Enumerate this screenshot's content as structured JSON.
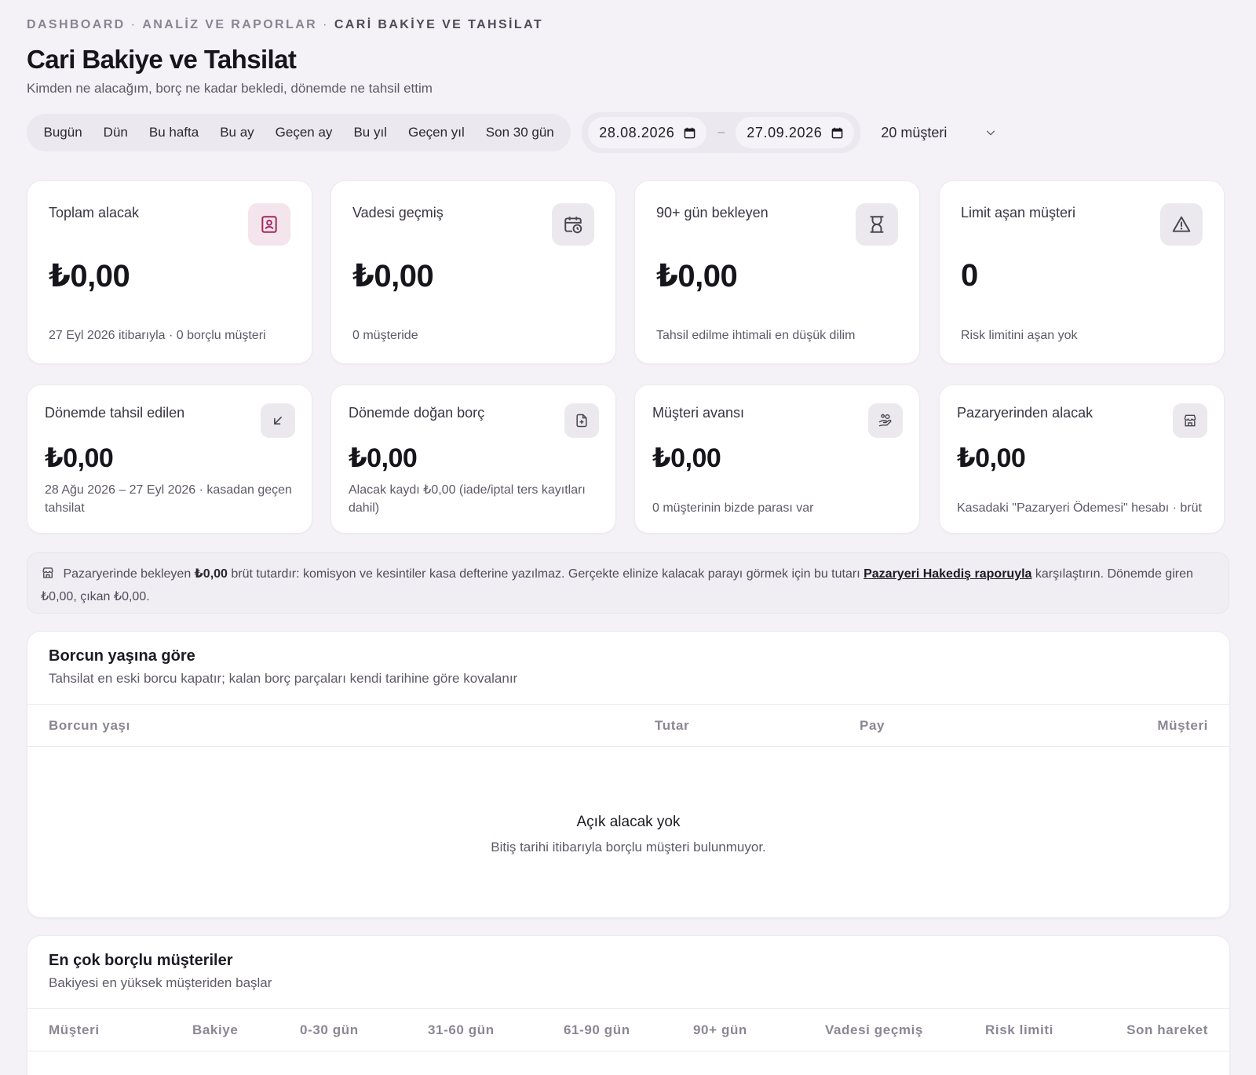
{
  "breadcrumb": {
    "item1": "DASHBOARD",
    "item2": "ANALİZ VE RAPORLAR",
    "item3": "CARİ BAKİYE VE TAHSİLAT",
    "separator": "·"
  },
  "header": {
    "title": "Cari Bakiye ve Tahsilat",
    "subtitle": "Kimden ne alacağım, borç ne kadar bekledi, dönemde ne tahsil ettim"
  },
  "filters": {
    "presets": [
      "Bugün",
      "Dün",
      "Bu hafta",
      "Bu ay",
      "Geçen ay",
      "Bu yıl",
      "Geçen yıl",
      "Son 30 gün"
    ],
    "start_date": "28.08.2026",
    "end_date": "27.09.2026",
    "date_separator": "–",
    "customer_select": "20 müşteri"
  },
  "kpis": [
    {
      "label": "Toplam alacak",
      "value": "₺0,00",
      "note": "27 Eyl 2026 itibarıyla · 0 borçlu müşteri",
      "icon": "contact-book-icon"
    },
    {
      "label": "Vadesi geçmiş",
      "value": "₺0,00",
      "note": "0 müşteride",
      "icon": "calendar-clock-icon"
    },
    {
      "label": "90+ gün bekleyen",
      "value": "₺0,00",
      "note": "Tahsil edilme ihtimali en düşük dilim",
      "icon": "hourglass-icon"
    },
    {
      "label": "Limit aşan müşteri",
      "value": "0",
      "note": "Risk limitini aşan yok",
      "icon": "warning-triangle-icon"
    }
  ],
  "period_kpis": [
    {
      "label": "Dönemde tahsil edilen",
      "value": "₺0,00",
      "note": "28 Ağu 2026 – 27 Eyl 2026 · kasadan geçen tahsilat",
      "icon": "arrow-down-left-icon"
    },
    {
      "label": "Dönemde doğan borç",
      "value": "₺0,00",
      "note": "Alacak kaydı ₺0,00 (iade/iptal ters kayıtları dahil)",
      "icon": "file-plus-icon"
    },
    {
      "label": "Müşteri avansı",
      "value": "₺0,00",
      "note": "0 müşterinin bizde parası var",
      "icon": "hand-coins-icon"
    },
    {
      "label": "Pazaryerinden alacak",
      "value": "₺0,00",
      "note": "Kasadaki \"Pazaryeri Ödemesi\" hesabı · brüt",
      "icon": "store-icon"
    }
  ],
  "banner": {
    "text_before": "Pazaryerinde bekleyen",
    "amount": "₺0,00",
    "text_middle": "brüt tutardır: komisyon ve kesintiler kasa defterine yazılmaz. Gerçekte elinize kalacak parayı görmek için bu tutarı",
    "link": "Pazaryeri Hakediş raporuyla",
    "text_after": "karşılaştırın. Dönemde giren ₺0,00, çıkan ₺0,00."
  },
  "aging": {
    "title": "Borcun yaşına göre",
    "subtitle": "Tahsilat en eski borcu kapatır; kalan borç parçaları kendi tarihine göre kovalanır",
    "columns": [
      "Borcun yaşı",
      "Tutar",
      "Pay",
      "Müşteri"
    ],
    "empty_title": "Açık alacak yok",
    "empty_subtitle": "Bitiş tarihi itibarıyla borçlu müşteri bulunmuyor."
  },
  "top_debtors": {
    "title": "En çok borçlu müşteriler",
    "subtitle": "Bakiyesi en yüksek müşteriden başlar",
    "columns": [
      "Müşteri",
      "Bakiye",
      "0-30 gün",
      "31-60 gün",
      "61-90 gün",
      "90+ gün",
      "Vadesi geçmiş",
      "Risk limiti",
      "Son hareket"
    ]
  },
  "colors": {
    "background": "#f4f2f6",
    "accent_pink": "#a0285f",
    "card": "#ffffff"
  }
}
